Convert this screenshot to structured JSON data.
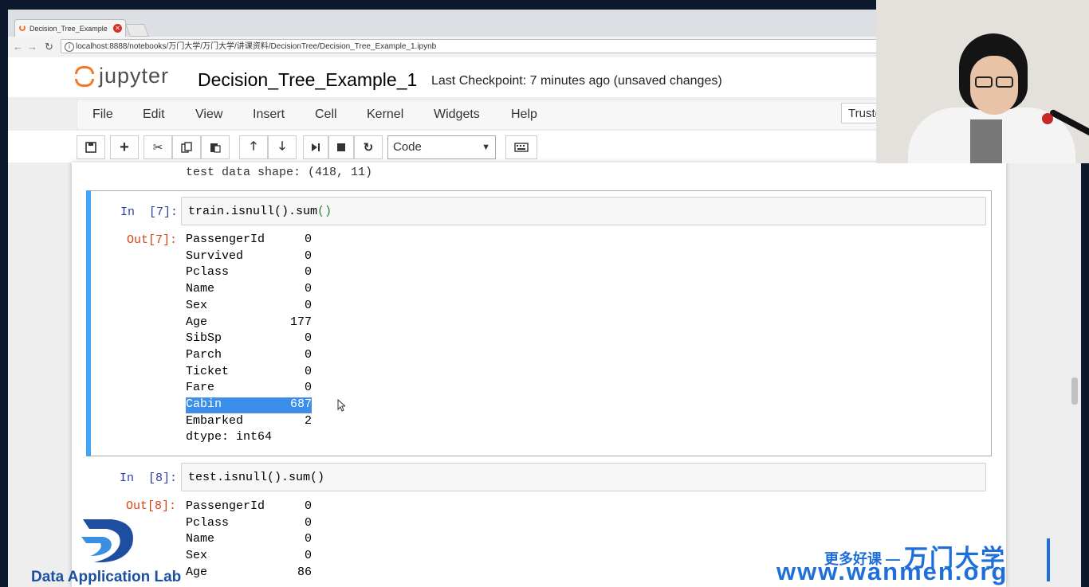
{
  "browser": {
    "tab_title": "Decision_Tree_Example",
    "url": "localhost:8888/notebooks/万门大学/万门大学/讲课资料/DecisionTree/Decision_Tree_Example_1.ipynb"
  },
  "jupyter": {
    "logo_text": "jupyter",
    "notebook_title": "Decision_Tree_Example_1",
    "checkpoint": "Last Checkpoint: 7 minutes ago (unsaved changes)",
    "menu": [
      "File",
      "Edit",
      "View",
      "Insert",
      "Cell",
      "Kernel",
      "Widgets",
      "Help"
    ],
    "trusted_label": "Truste",
    "cell_type": "Code"
  },
  "notebook": {
    "previous_output": "test data shape: (418, 11)",
    "cell7": {
      "in_prompt": "In  [7]:",
      "code_prefix": "train.isnull().sum",
      "code_parens": "()",
      "out_prompt": "Out[7]:",
      "rows": [
        {
          "key": "PassengerId",
          "value": "0"
        },
        {
          "key": "Survived",
          "value": "0"
        },
        {
          "key": "Pclass",
          "value": "0"
        },
        {
          "key": "Name",
          "value": "0"
        },
        {
          "key": "Sex",
          "value": "0"
        },
        {
          "key": "Age",
          "value": "177"
        },
        {
          "key": "SibSp",
          "value": "0"
        },
        {
          "key": "Parch",
          "value": "0"
        },
        {
          "key": "Ticket",
          "value": "0"
        },
        {
          "key": "Fare",
          "value": "0"
        },
        {
          "key": "Cabin",
          "value": "687"
        },
        {
          "key": "Embarked",
          "value": "2"
        }
      ],
      "dtype": "dtype: int64"
    },
    "cell8": {
      "in_prompt": "In  [8]:",
      "code": "test.isnull().sum()",
      "out_prompt": "Out[8]:",
      "rows": [
        {
          "key": "PassengerId",
          "value": "0"
        },
        {
          "key": "Pclass",
          "value": "0"
        },
        {
          "key": "Name",
          "value": "0"
        },
        {
          "key": "Sex",
          "value": "0"
        },
        {
          "key": "Age",
          "value": "86"
        }
      ]
    }
  },
  "watermarks": {
    "lab_name": "Data Application Lab",
    "promo_prefix": "更多好课 —",
    "promo_brand": "万门大学",
    "site": "www.wanmen.org"
  },
  "colors": {
    "selected_cell_bar": "#42a5f5",
    "in_prompt": "#303f9f",
    "out_prompt": "#d84315",
    "selection_highlight": "#3b8eea",
    "jupyter_orange": "#f37726",
    "watermark_blue": "#1e6fd9"
  }
}
